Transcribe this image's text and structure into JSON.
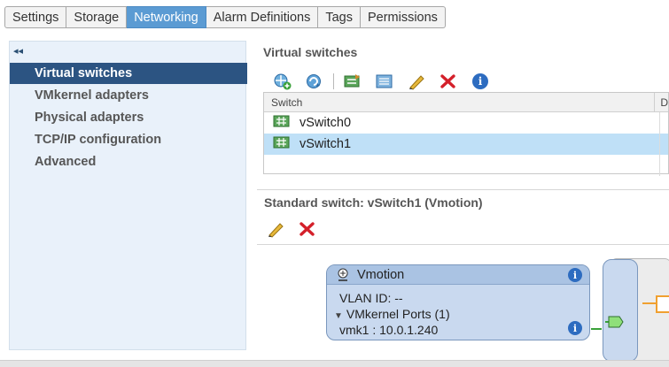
{
  "tabs": [
    {
      "label": "Settings",
      "active": false
    },
    {
      "label": "Storage",
      "active": false
    },
    {
      "label": "Networking",
      "active": true
    },
    {
      "label": "Alarm Definitions",
      "active": false
    },
    {
      "label": "Tags",
      "active": false
    },
    {
      "label": "Permissions",
      "active": false
    }
  ],
  "sidebar": {
    "collapse_glyph": "◂◂",
    "items": [
      {
        "label": "Virtual switches",
        "selected": true
      },
      {
        "label": "VMkernel adapters",
        "selected": false
      },
      {
        "label": "Physical adapters",
        "selected": false
      },
      {
        "label": "TCP/IP configuration",
        "selected": false
      },
      {
        "label": "Advanced",
        "selected": false
      }
    ]
  },
  "main": {
    "title": "Virtual switches",
    "toolbar_icons": [
      "add-networking-icon",
      "refresh-icon",
      "migrate-adapters-icon",
      "manage-physical-adapters-icon",
      "edit-icon",
      "remove-icon",
      "info-icon"
    ],
    "grid": {
      "columns": [
        "Switch",
        "D"
      ],
      "rows": [
        {
          "name": "vSwitch0",
          "selected": false
        },
        {
          "name": "vSwitch1",
          "selected": true
        }
      ]
    },
    "detail_title": "Standard switch: vSwitch1 (Vmotion)",
    "detail_toolbar_icons": [
      "edit-icon",
      "remove-icon"
    ],
    "diagram": {
      "portgroup_name": "Vmotion",
      "vlan": "VLAN ID: --",
      "ports_label": "VMkernel Ports (1)",
      "vmk": "vmk1 : 10.0.1.240"
    }
  },
  "colors": {
    "active_tab": "#5b9bd3",
    "nav_selected": "#2c5482",
    "row_selected": "#bfe0f7",
    "portgroup_fill": "#c9d9ef",
    "uplink_line": "#f0a030"
  }
}
